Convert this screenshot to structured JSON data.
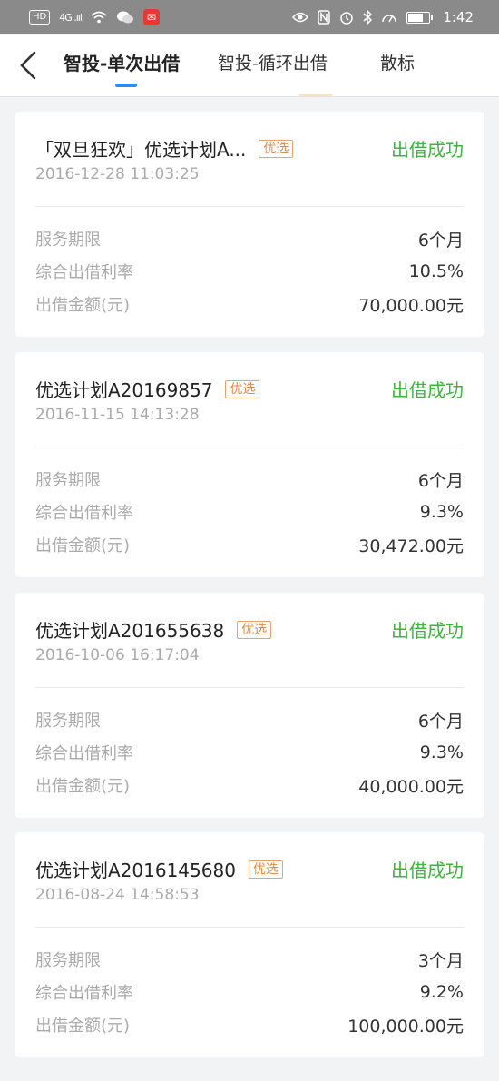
{
  "status_bar": {
    "network": "HD",
    "signal": "4G .ııl",
    "time": "1:42",
    "battery_fraction": 0.65
  },
  "nav": {
    "tabs": [
      {
        "label": "智投-单次出借",
        "active": true
      },
      {
        "label": "智投-循环出借",
        "active": false
      },
      {
        "label": "散标",
        "active": false
      }
    ]
  },
  "labels": {
    "term": "服务期限",
    "rate": "综合出借利率",
    "amount": "出借金额(元)"
  },
  "records": [
    {
      "title": "「双旦狂欢」优选计划A...",
      "tag": "优选",
      "status": "出借成功",
      "date": "2016-12-28 11:03:25",
      "term": "6个月",
      "rate": "10.5%",
      "amount": "70,000.00元"
    },
    {
      "title": "优选计划A20169857",
      "tag": "优选",
      "status": "出借成功",
      "date": "2016-11-15 14:13:28",
      "term": "6个月",
      "rate": "9.3%",
      "amount": "30,472.00元"
    },
    {
      "title": "优选计划A201655638",
      "tag": "优选",
      "status": "出借成功",
      "date": "2016-10-06 16:17:04",
      "term": "6个月",
      "rate": "9.3%",
      "amount": "40,000.00元"
    },
    {
      "title": "优选计划A2016145680",
      "tag": "优选",
      "status": "出借成功",
      "date": "2016-08-24 14:58:53",
      "term": "3个月",
      "rate": "9.2%",
      "amount": "100,000.00元"
    }
  ],
  "colors": {
    "accent": "#2d8cf0",
    "success": "#3cb53c",
    "tag": "#e08a44"
  }
}
